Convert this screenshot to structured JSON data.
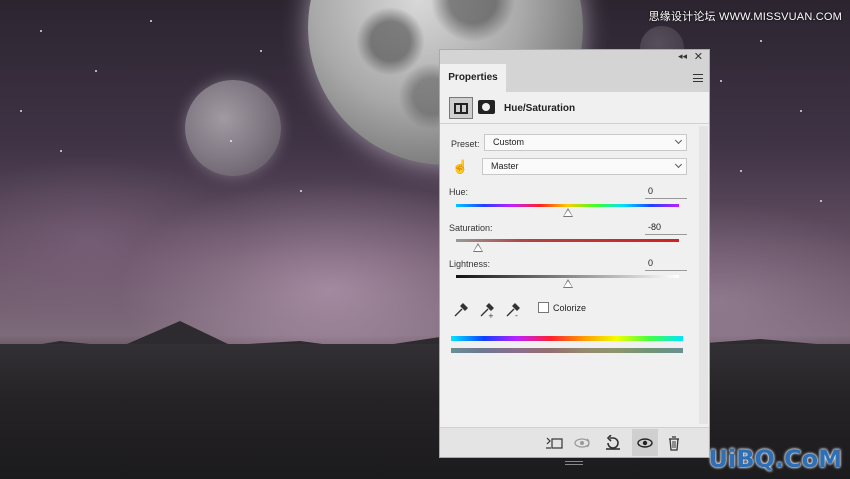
{
  "watermark": {
    "top": "思缘设计论坛 WWW.MISSVUAN.COM",
    "bottom": "UiBQ.CoM"
  },
  "panel": {
    "tab_label": "Properties",
    "adjustment_title": "Hue/Saturation",
    "preset": {
      "label": "Preset:",
      "value": "Custom"
    },
    "channel": {
      "value": "Master"
    },
    "hue": {
      "label": "Hue:",
      "value": "0",
      "level_percent": 50
    },
    "saturation": {
      "label": "Saturation:",
      "value": "-80",
      "level_percent": 10
    },
    "lightness": {
      "label": "Lightness:",
      "value": "0",
      "level_percent": 50
    },
    "colorize": {
      "label": "Colorize",
      "checked": false
    }
  },
  "colors": {
    "panel_bg": "#f0f0f0",
    "tab_bar": "#d4d4d4",
    "saturation_track": "#c43a3a"
  }
}
